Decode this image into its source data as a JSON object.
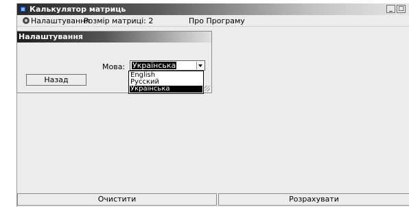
{
  "window": {
    "title": "Калькулятор матриць",
    "controls": [
      "_",
      "□"
    ]
  },
  "menu": {
    "settings": "Налаштування",
    "matrix_size": "Розмір матриці: 2",
    "about": "Про Програму"
  },
  "settings_panel": {
    "title": "Налаштування",
    "language_label": "Мова:",
    "language_value": "Українська",
    "language_options": [
      "English",
      "Русский",
      "Українська"
    ],
    "back_button": "Назад"
  },
  "bottom_buttons": {
    "clear": "Очистити",
    "calculate": "Розрахувати"
  },
  "icons": {
    "app": "matrix-calculator-icon",
    "settings": "gear-icon"
  },
  "colors": {
    "titlebar_dark": "#2b2b2b",
    "window_bg": "#ececec",
    "selection": "#000000"
  }
}
